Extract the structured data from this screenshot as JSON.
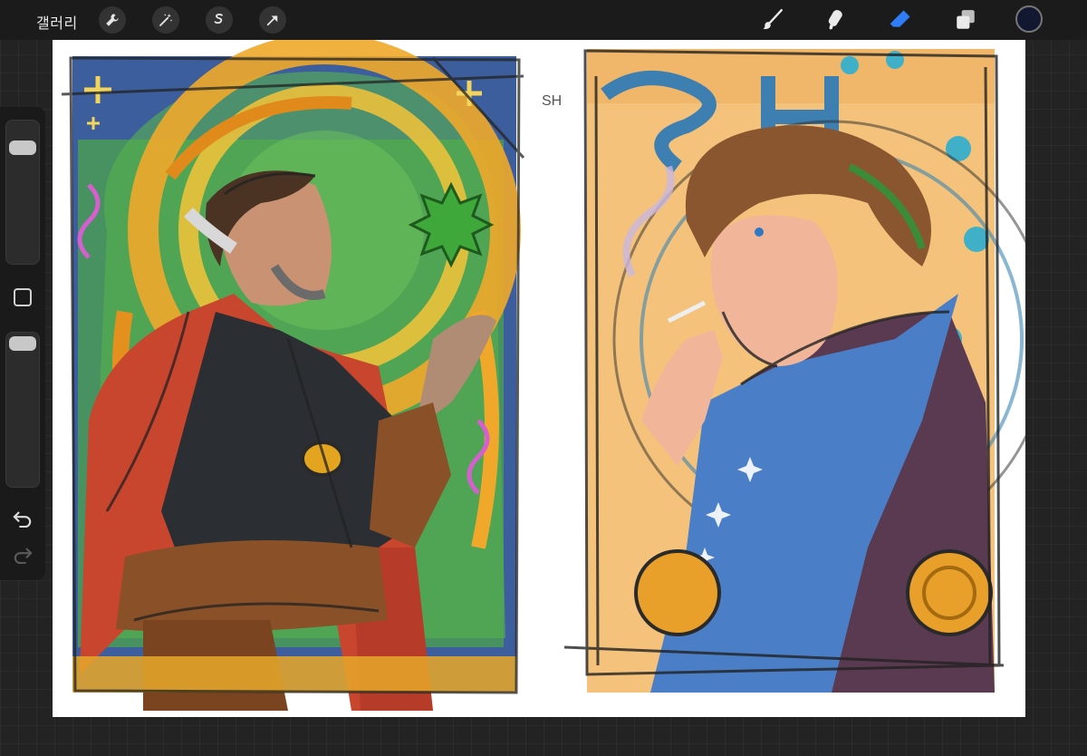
{
  "toolbar": {
    "gallery_label": "갤러리",
    "left_tools": [
      "wrench-icon",
      "magic-wand-icon",
      "selection-icon",
      "transform-arrow-icon"
    ],
    "right_tools": [
      "brush-icon",
      "smudge-icon",
      "eraser-icon",
      "layers-icon"
    ],
    "active_tool": "eraser",
    "current_color": "#111830",
    "accent_color": "#2f7df6"
  },
  "sidebar": {
    "brush_size_level": 0.1,
    "opacity_level": 0.05,
    "buttons": [
      "modify-button",
      "undo-icon",
      "redo-icon"
    ]
  },
  "canvas": {
    "background": "#ffffff",
    "sketch_annotation": "SH"
  }
}
